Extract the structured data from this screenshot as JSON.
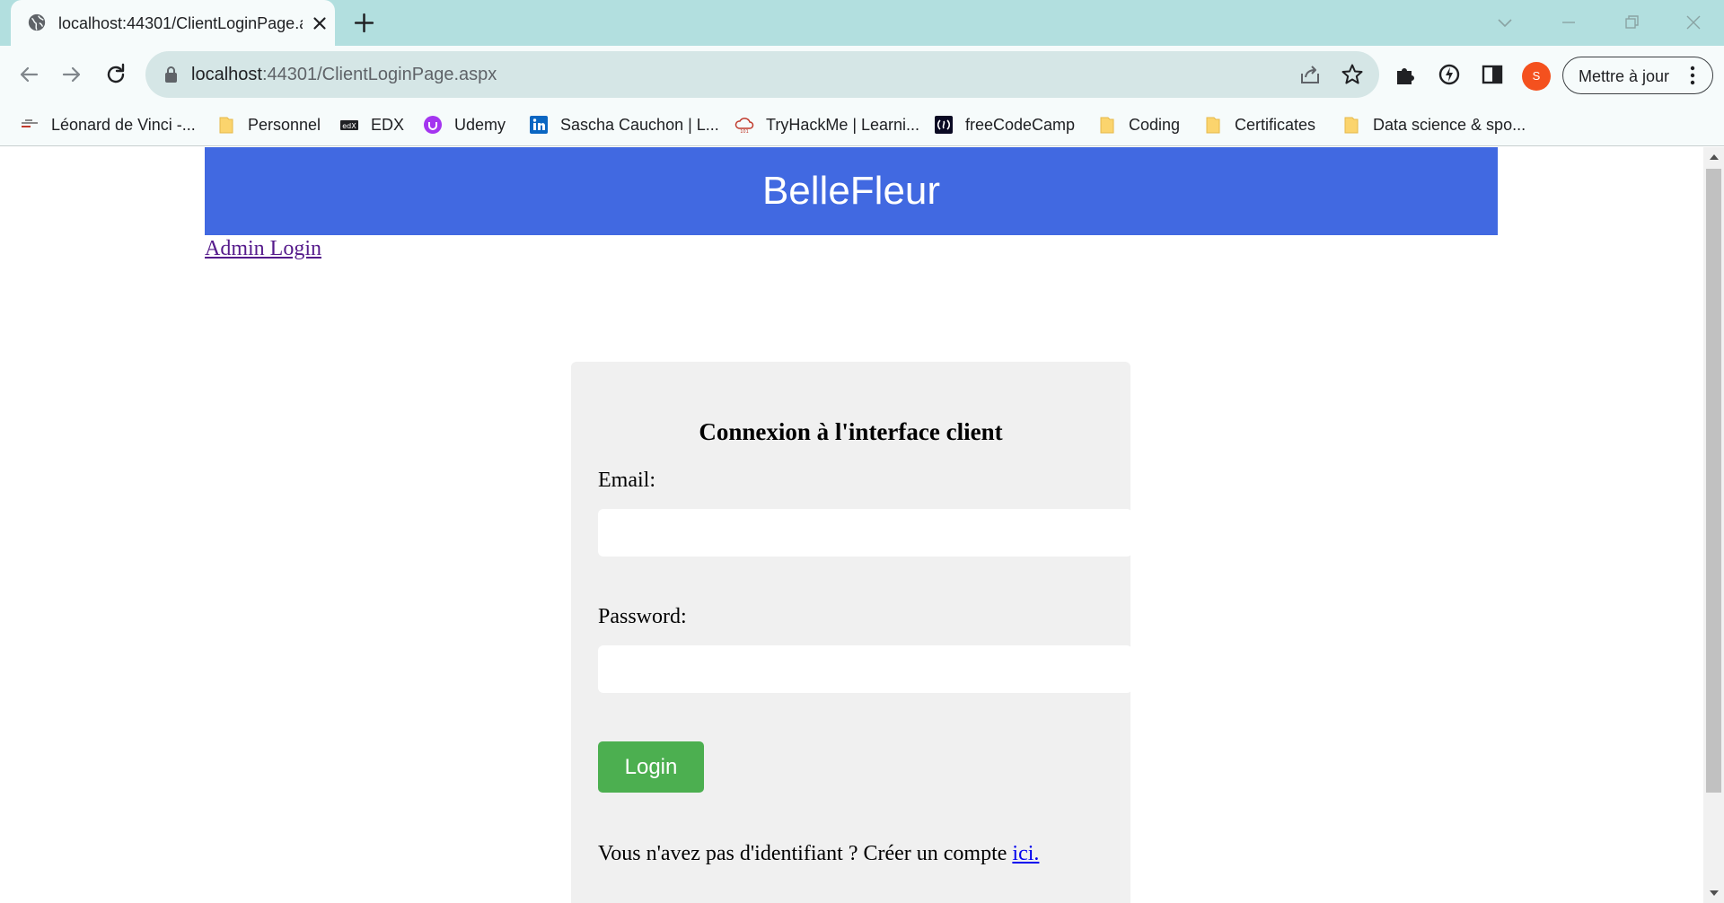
{
  "browser": {
    "tab_title": "localhost:44301/ClientLoginPage.aspx",
    "url_host": "localhost",
    "url_rest": ":44301/ClientLoginPage.aspx",
    "profile_initial": "S",
    "update_label": "Mettre à jour",
    "accent_colors": {
      "tabstrip": "#b2dfdf",
      "toolbar": "#f6fbfb",
      "omnibox": "#d5e6e6",
      "avatar": "#f4511e"
    },
    "bookmarks": [
      {
        "label": "Léonard de Vinci -...",
        "icon": "school-logo-icon"
      },
      {
        "label": "Personnel",
        "icon": "folder-icon"
      },
      {
        "label": "EDX",
        "icon": "edx-logo-icon"
      },
      {
        "label": "Udemy",
        "icon": "udemy-logo-icon"
      },
      {
        "label": "Sascha Cauchon | L...",
        "icon": "linkedin-logo-icon"
      },
      {
        "label": "TryHackMe | Learni...",
        "icon": "tryhackme-logo-icon"
      },
      {
        "label": "freeCodeCamp",
        "icon": "freecodecamp-logo-icon"
      },
      {
        "label": "Coding",
        "icon": "folder-icon"
      },
      {
        "label": "Certificates",
        "icon": "folder-icon"
      },
      {
        "label": "Data science & spo...",
        "icon": "folder-icon"
      }
    ]
  },
  "page": {
    "brand": "BelleFleur",
    "brand_color": "#4169e1",
    "admin_link": "Admin Login",
    "form": {
      "title": "Connexion à l'interface client",
      "email_label": "Email:",
      "email_value": "",
      "password_label": "Password:",
      "password_value": "",
      "login_label": "Login",
      "login_color": "#4caf50",
      "signup_text": "Vous n'avez pas d'identifiant ? Créer un compte ",
      "signup_link": "ici."
    }
  }
}
